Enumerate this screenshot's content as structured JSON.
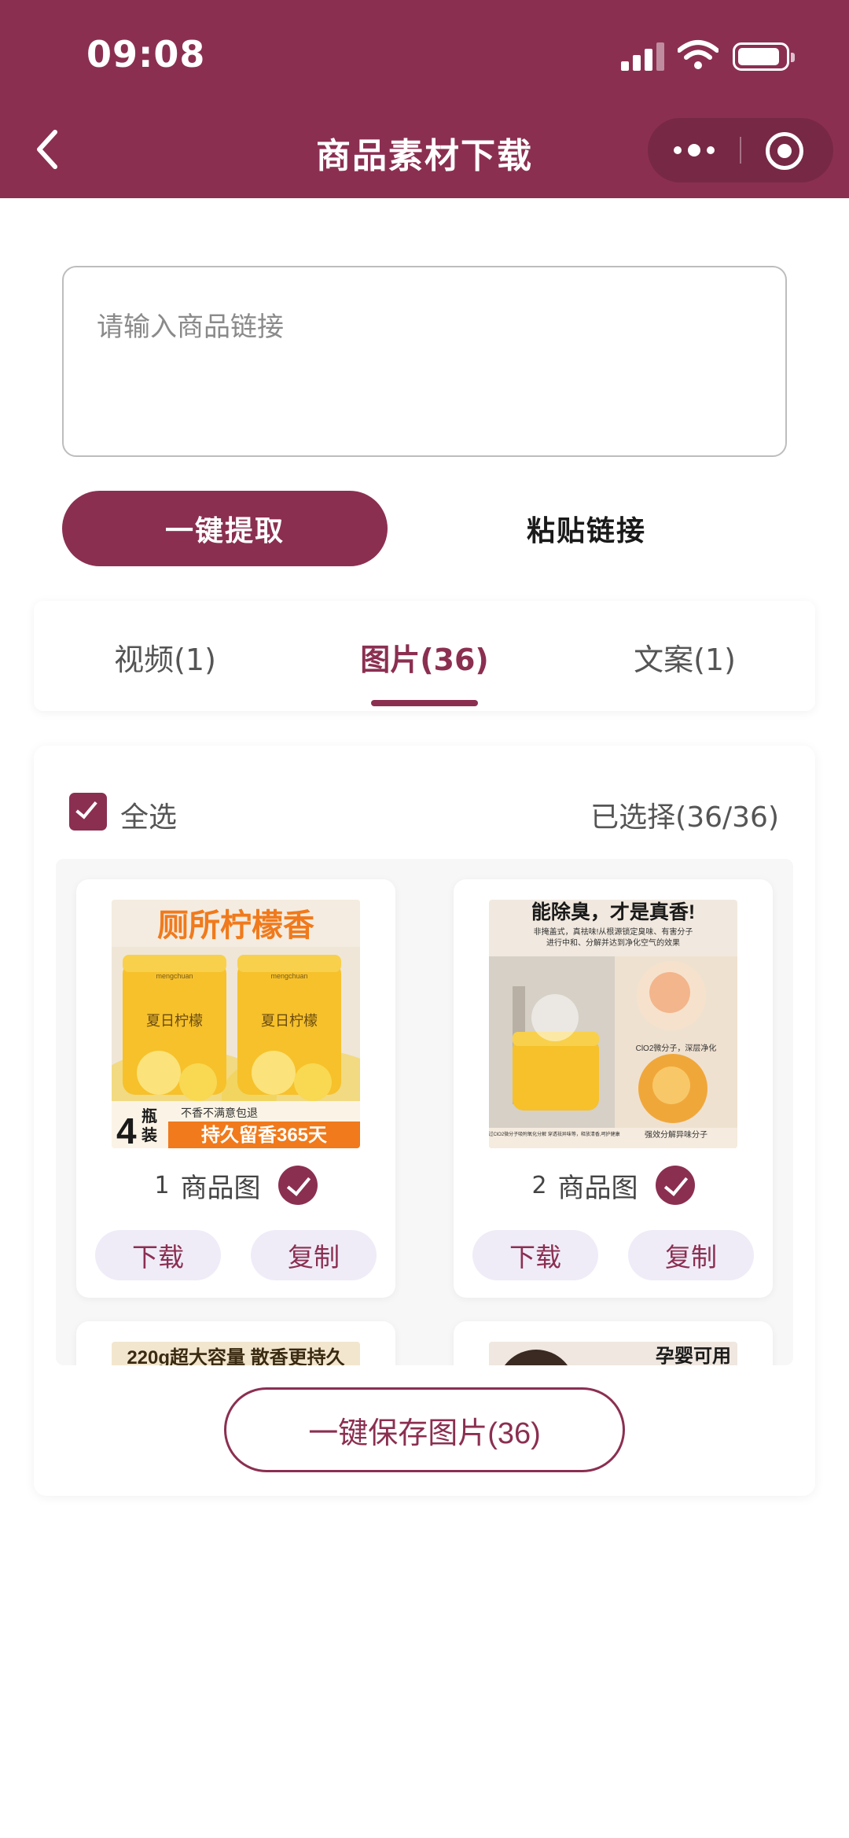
{
  "status_bar": {
    "time": "09:08"
  },
  "nav": {
    "title": "商品素材下载"
  },
  "link_input": {
    "placeholder": "请输入商品链接",
    "value": ""
  },
  "actions": {
    "extract_label": "一键提取",
    "paste_label": "粘贴链接"
  },
  "tabs": [
    {
      "label": "视频(1)",
      "active": false
    },
    {
      "label": "图片(36)",
      "active": true
    },
    {
      "label": "文案(1)",
      "active": false
    }
  ],
  "selection": {
    "select_all_label": "全选",
    "selected_label": "已选择(36/36)",
    "all_checked": true
  },
  "images": [
    {
      "index": "1",
      "type_label": "商品图",
      "checked": true,
      "download_label": "下载",
      "copy_label": "复制",
      "thumb_text": {
        "headline": "厕所柠檬香",
        "product_name": "夏日柠檬",
        "brand": "mengchuan",
        "pack": "4",
        "pack_unit_1": "瓶",
        "pack_unit_2": "装",
        "promise": "不香不满意包退",
        "banner": "持久留香365天"
      }
    },
    {
      "index": "2",
      "type_label": "商品图",
      "checked": true,
      "download_label": "下载",
      "copy_label": "复制",
      "thumb_text": {
        "headline": "能除臭，才是真香!",
        "sub1": "非掩盖式，真祛味!从根源锁定臭味、有害分子",
        "sub2": "进行中和、分解并达到净化空气的效果",
        "mol1": "ClO2微分子，深层净化",
        "mol2": "强效分解异味分子",
        "note": "通过ClO2微分子吸附氧化分解 穿透祛异味等，释放清香,呵护健康"
      }
    },
    {
      "thumb_text": {
        "headline": "220g超大容量 散香更持久"
      }
    },
    {
      "thumb_text": {
        "headline": "孕婴可用"
      }
    }
  ],
  "footer": {
    "save_all_label": "一键保存图片(36)"
  },
  "colors": {
    "brand": "#8b2f51",
    "chip_bg": "#efecf8",
    "orange": "#f07a1c",
    "lemon": "#f6c12b"
  }
}
